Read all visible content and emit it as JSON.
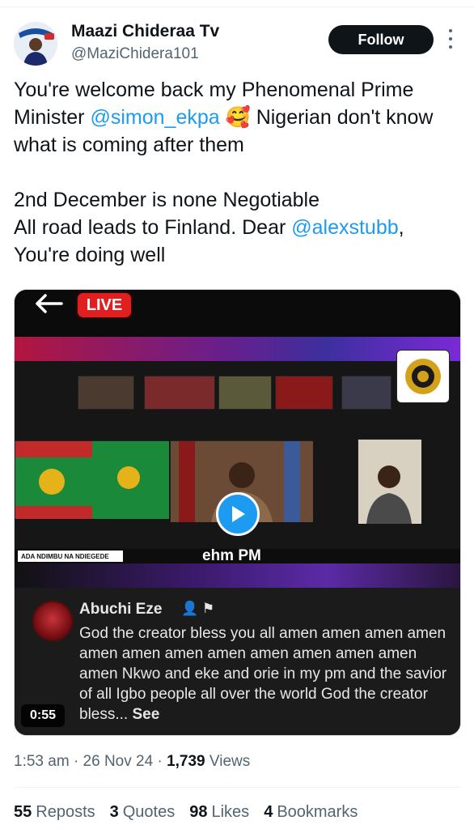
{
  "author": {
    "name": "Maazi Chideraa Tv",
    "handle": "@MaziChidera101",
    "follow_label": "Follow"
  },
  "tweet": {
    "line1": "You're welcome back my Phenomenal Prime",
    "line2_pre": "Minister ",
    "mention1": "@simon_ekpa",
    "emoji": "🥰",
    "line2_post": " Nigerian don't know",
    "line3": "what is coming after them",
    "line4": "2nd December is none Negotiable",
    "line5_pre": "All road leads to Finland. Dear ",
    "mention2": "@alexstubb",
    "line5_post": ",",
    "line6": "You're doing well"
  },
  "media": {
    "live_label": "LIVE",
    "overlay_caption": "ehm PM",
    "ada_label": "ADA NDIMBU NA NDIEGEDE",
    "duration": "0:55",
    "comment": {
      "author": "Abuchi Eze",
      "text": "God the creator bless you all amen amen amen amen amen amen amen amen amen amen amen amen amen Nkwo and eke and orie in my pm and the savior of all Igbo people all over the world God the creator bless...",
      "see_more": "See"
    }
  },
  "meta": {
    "time": "1:53 am",
    "date": "26 Nov 24",
    "views_count": "1,739",
    "views_label": "Views"
  },
  "stats": {
    "reposts_count": "55",
    "reposts_label": "Reposts",
    "quotes_count": "3",
    "quotes_label": "Quotes",
    "likes_count": "98",
    "likes_label": "Likes",
    "bookmarks_count": "4",
    "bookmarks_label": "Bookmarks"
  },
  "colors": {
    "link": "#1d9bf0",
    "live_red": "#e02020",
    "text_secondary": "#536471"
  },
  "icons": [
    "more-icon",
    "back-arrow-icon",
    "play-icon",
    "person-add-icon",
    "flag-icon"
  ]
}
